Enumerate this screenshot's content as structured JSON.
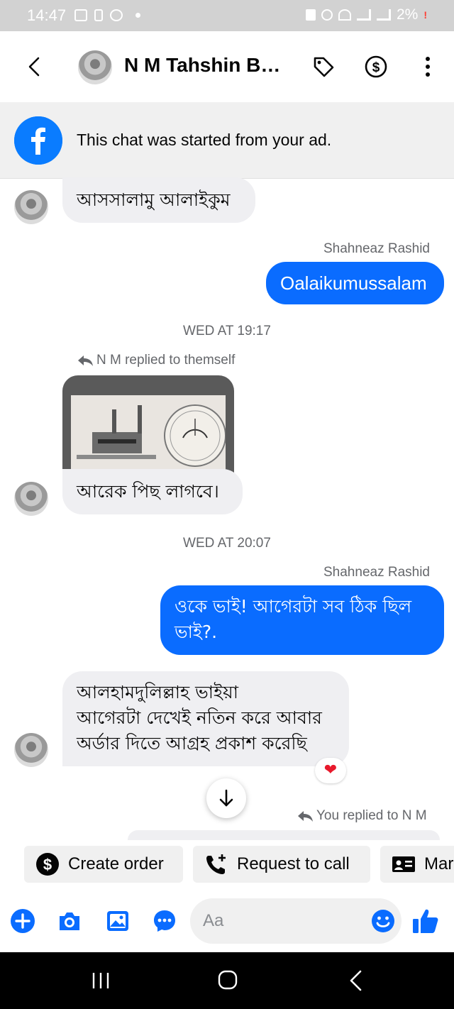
{
  "status_bar": {
    "time": "14:47",
    "battery": "2%"
  },
  "header": {
    "title": "N M Tahshin B…"
  },
  "ad_banner": {
    "text": "This chat was started from your ad."
  },
  "messages": {
    "m1": "আসসালামু আলাইকুম",
    "m2_sender": "Shahneaz Rashid",
    "m2": "Oalaikumussalam",
    "ts1": "WED AT 19:17",
    "reply1": "N M replied to themself",
    "m3": "আরেক পিছ লাগবে।",
    "ts2": "WED AT 20:07",
    "m4_sender": "Shahneaz Rashid",
    "m4_line1": "ওকে ভাই!  আগেরটা সব ঠিক ছিল",
    "m4_line2": "ভাই?.",
    "m5_line1": "আলহামদুলিল্লাহ ভাইয়া",
    "m5_line2": "আগেরটা দেখেই নতিন করে আবার",
    "m5_line3": "অর্ডার দিতে আগ্রহ প্রকাশ করেছি",
    "reply2": "You replied to N M"
  },
  "quick_actions": {
    "create_order": "Create order",
    "request_call": "Request to call",
    "mark": "Mar"
  },
  "composer": {
    "placeholder": "Aa"
  },
  "colors": {
    "accent": "#0a6cff",
    "incoming_bubble": "#efeff2",
    "heart": "#e8192c"
  }
}
